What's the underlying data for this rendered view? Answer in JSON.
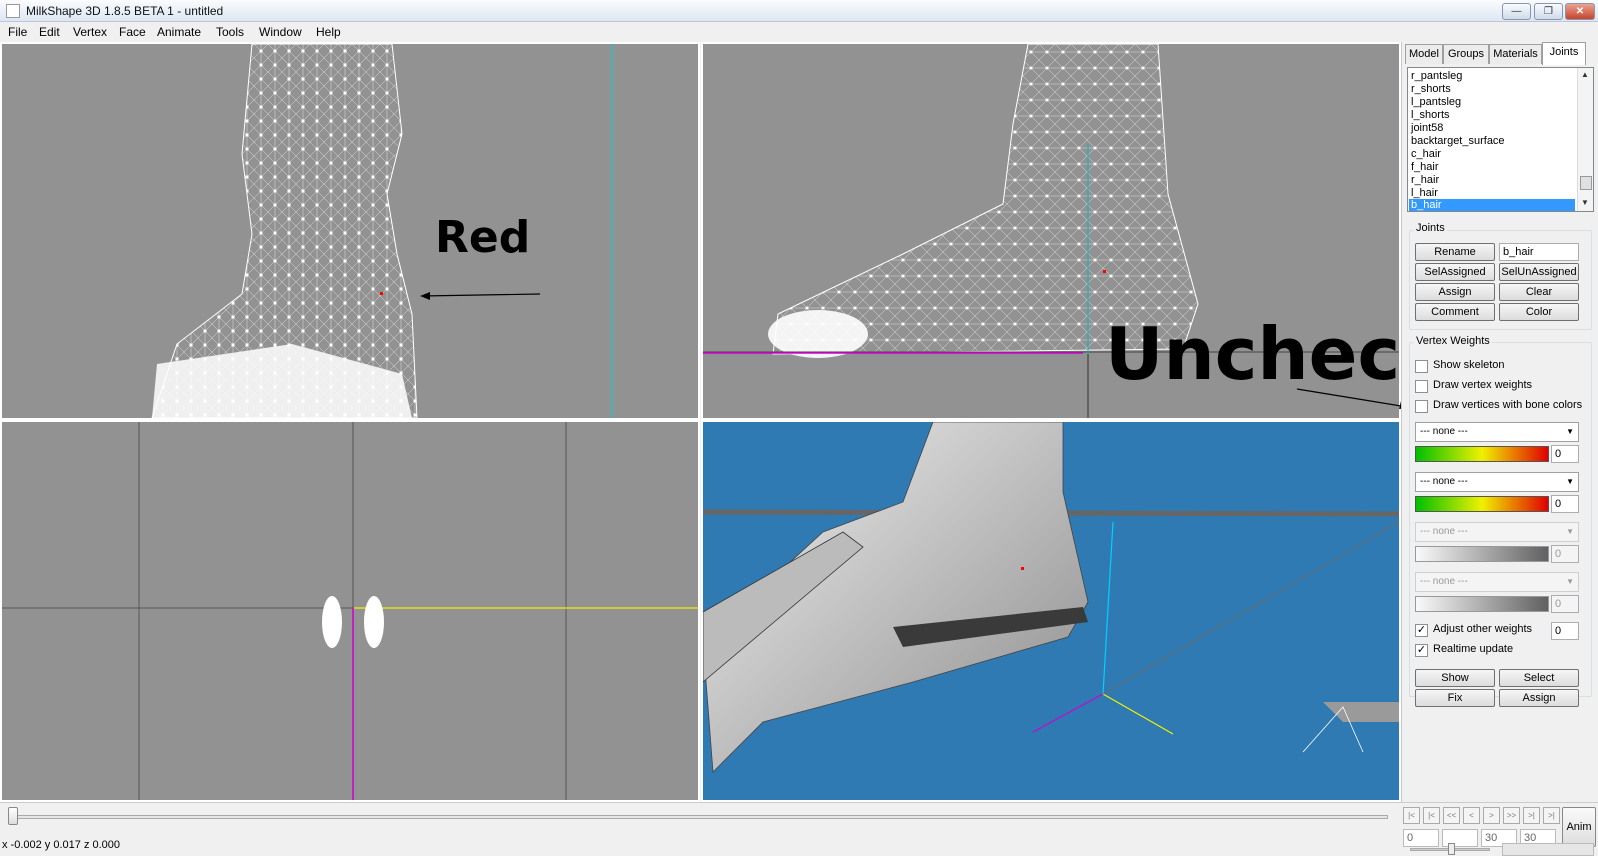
{
  "window": {
    "title": "MilkShape 3D 1.8.5 BETA 1 - untitled",
    "min_glyph": "—",
    "max_glyph": "❐",
    "close_glyph": "✕"
  },
  "menu": [
    "File",
    "Edit",
    "Vertex",
    "Face",
    "Animate",
    "Tools",
    "Window",
    "Help"
  ],
  "panel": {
    "tabs": [
      "Model",
      "Groups",
      "Materials",
      "Joints"
    ],
    "active_tab": "Joints",
    "joints": [
      "r_pantsleg",
      "r_shorts",
      "l_pantsleg",
      "l_shorts",
      "joint58",
      "backtarget_surface",
      "c_hair",
      "f_hair",
      "r_hair",
      "l_hair",
      "b_hair"
    ],
    "selected_joint": "b_hair",
    "joints_group_label": "Joints",
    "rename_label": "Rename",
    "name_value": "b_hair",
    "selassigned_label": "SelAssigned",
    "selunassigned_label": "SelUnAssigned",
    "assign_label": "Assign",
    "clear_label": "Clear",
    "comment_label": "Comment",
    "color_label": "Color",
    "vw_group_label": "Vertex Weights",
    "show_skeleton": "Show skeleton",
    "draw_vertex_weights": "Draw vertex weights",
    "draw_bone_colors": "Draw vertices with bone colors",
    "dropdowns": [
      {
        "value": "--- none ---",
        "weight": "0",
        "enabled": true
      },
      {
        "value": "--- none ---",
        "weight": "0",
        "enabled": true
      },
      {
        "value": "--- none ---",
        "weight": "0",
        "enabled": false
      },
      {
        "value": "--- none ---",
        "weight": "0",
        "enabled": false
      }
    ],
    "adjust_other_weights": "Adjust other weights",
    "adjust_value": "0",
    "realtime_update": "Realtime update",
    "check_mark": "✓",
    "show_label": "Show",
    "select_label": "Select",
    "fix_label": "Fix",
    "assign2_label": "Assign",
    "colors": {
      "grad_from": "#00c000",
      "grad_mid": "#f0f000",
      "grad_to": "#e00000"
    }
  },
  "annotations": {
    "red": "Red",
    "uncheck": "Uncheck"
  },
  "timeline": {
    "buttons": [
      "|<",
      "|<",
      "<<",
      "<",
      ">",
      ">>",
      ">|",
      ">|"
    ],
    "start": "0",
    "current": "",
    "frame": "30",
    "end": "30",
    "anim_label": "Anim"
  },
  "status": "x -0.002 y 0.017 z 0.000"
}
